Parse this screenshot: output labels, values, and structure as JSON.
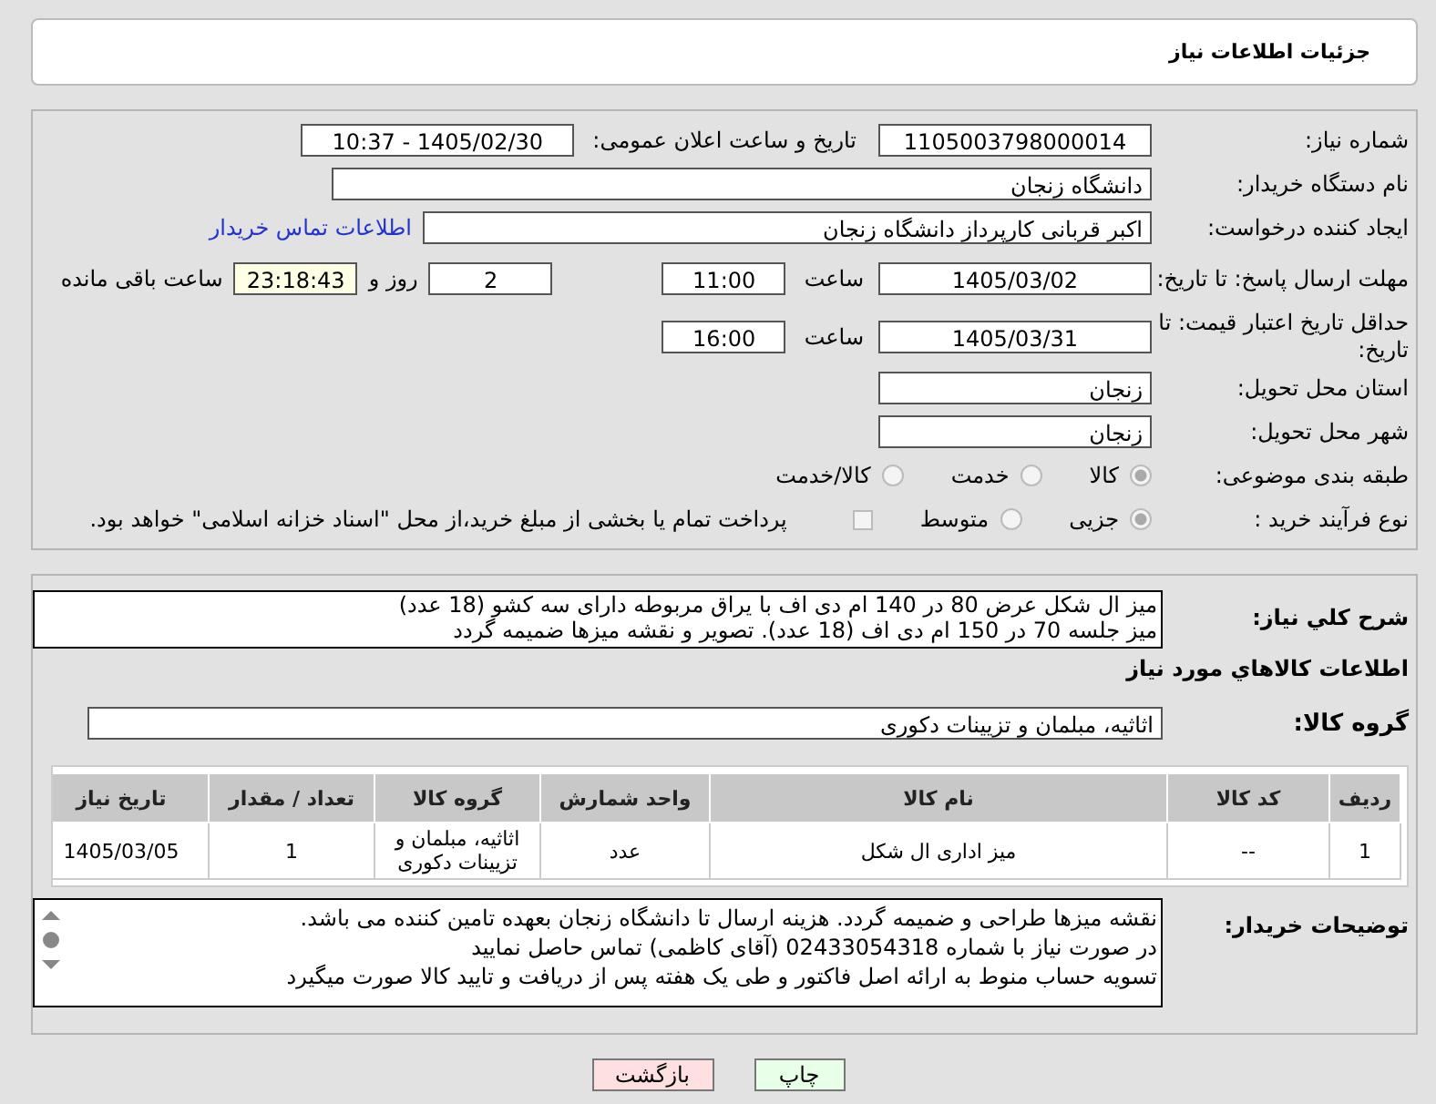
{
  "header": {
    "title": "جزئیات اطلاعات نیاز"
  },
  "need_number": {
    "label": "شماره نیاز:",
    "value": "1105003798000014"
  },
  "announce": {
    "label": "تاریخ و ساعت اعلان عمومی:",
    "value": "1405/02/30 - 10:37"
  },
  "buyer_org": {
    "label": "نام دستگاه خریدار:",
    "value": "دانشگاه زنجان"
  },
  "creator": {
    "label": "ایجاد کننده درخواست:",
    "value": "اکبر قربانی کارپرداز دانشگاه زنجان",
    "link": "اطلاعات تماس خریدار"
  },
  "deadline": {
    "label": "مهلت ارسال پاسخ: تا تاریخ:",
    "date": "1405/03/02",
    "time_label": "ساعت",
    "time": "11:00",
    "days": "2",
    "days_label": "روز و",
    "remaining": "23:18:43",
    "remaining_label": "ساعت باقی مانده"
  },
  "validity": {
    "label": "حداقل تاریخ اعتبار قیمت: تا تاریخ:",
    "date": "1405/03/31",
    "time_label": "ساعت",
    "time": "16:00"
  },
  "province": {
    "label": "استان محل تحویل:",
    "value": "زنجان"
  },
  "city": {
    "label": "شهر محل تحویل:",
    "value": "زنجان"
  },
  "category": {
    "label": "طبقه بندی موضوعی:",
    "options": [
      {
        "label": "کالا",
        "selected": true
      },
      {
        "label": "خدمت",
        "selected": false
      },
      {
        "label": "کالا/خدمت",
        "selected": false
      }
    ]
  },
  "process": {
    "label": "نوع فرآیند خرید :",
    "options": [
      {
        "label": "جزیی",
        "selected": true
      },
      {
        "label": "متوسط",
        "selected": false
      }
    ],
    "payment": {
      "checked": false,
      "label": "پرداخت تمام یا بخشی از مبلغ خرید،از محل \"اسناد خزانه اسلامی\" خواهد بود."
    }
  },
  "description": {
    "label": "شرح کلي نياز:",
    "lines": [
      "میز ال شکل عرض 80 در 140 ام دی اف با یراق مربوطه دارای سه کشو (18 عدد)",
      "میز جلسه 70 در 150 ام دی اف (18 عدد). تصویر و نقشه میزها ضمیمه گردد"
    ]
  },
  "goods_title": "اطلاعات کالاهاي مورد نياز",
  "goods_group": {
    "label": "گروه کالا:",
    "value": "اثاثیه، مبلمان و تزیینات دکوری"
  },
  "table": {
    "columns": [
      "ردیف",
      "کد کالا",
      "نام کالا",
      "واحد شمارش",
      "گروه کالا",
      "تعداد / مقدار",
      "تاریخ نیاز"
    ],
    "rows": [
      [
        "1",
        "--",
        "میز اداری ال شکل",
        "عدد",
        "اثاثیه، مبلمان و تزیینات دکوری",
        "1",
        "1405/03/05"
      ]
    ]
  },
  "notes": {
    "label": "توضیحات خریدار:",
    "lines": [
      "نقشه میزها طراحی و ضمیمه گردد. هزینه ارسال تا دانشگاه زنجان بعهده تامین کننده می باشد.",
      "در صورت نیاز با شماره 02433054318 (آقای کاظمی) تماس حاصل نمایید",
      "تسویه حساب منوط به ارائه اصل فاکتور و طی یک هفته پس از دریافت و تایید کالا صورت میگیرد"
    ]
  },
  "buttons": [
    {
      "label": "چاپ",
      "kind": "print"
    },
    {
      "label": "بازگشت",
      "kind": "back"
    }
  ]
}
